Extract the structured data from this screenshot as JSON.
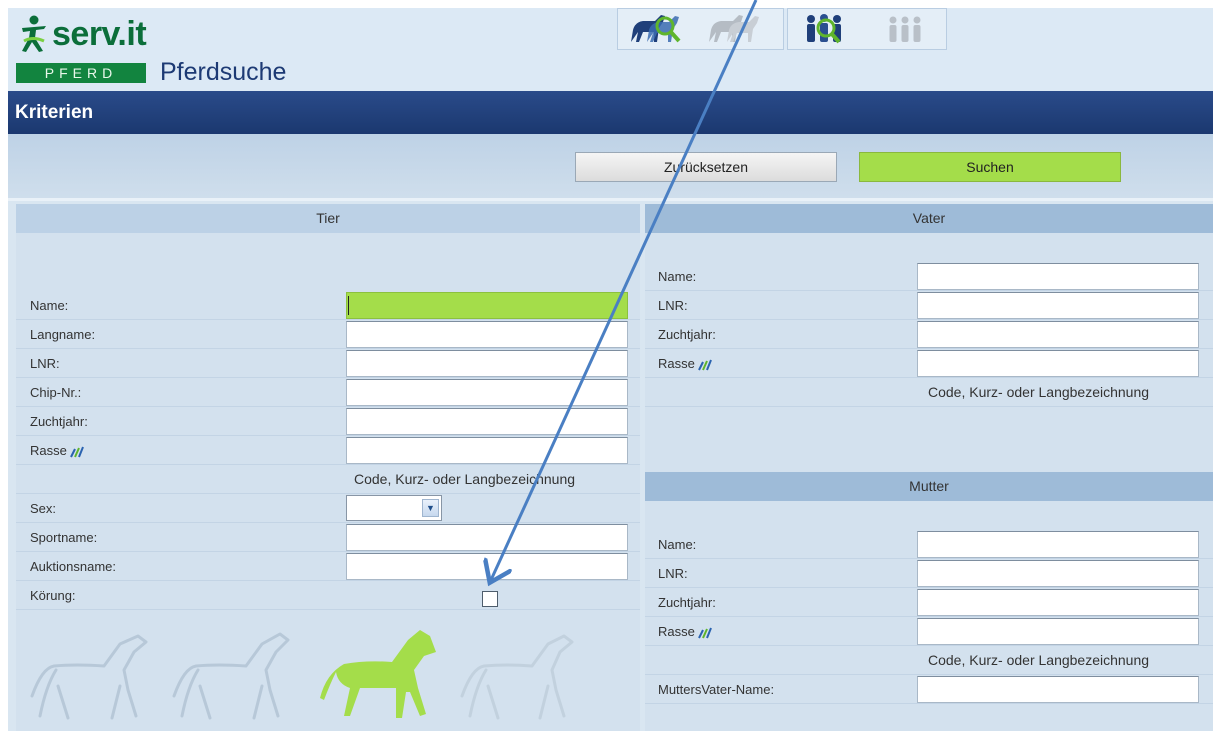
{
  "header": {
    "logo_text": "serv.it",
    "logo_sub": "PFERD",
    "title": "Pferdsuche"
  },
  "titlebar": {
    "label": "Kriterien"
  },
  "toolbar": {
    "reset_label": "Zurücksetzen",
    "search_label": "Suchen"
  },
  "tier": {
    "heading": "Tier",
    "fields": {
      "name": "Name:",
      "langname": "Langname:",
      "lnr": "LNR:",
      "chip": "Chip-Nr.:",
      "zuchtjahr": "Zuchtjahr:",
      "rasse": "Rasse",
      "sex": "Sex:",
      "sportname": "Sportname:",
      "auktionsname": "Auktionsname:",
      "koerung": "Körung:"
    },
    "hint": "Code, Kurz- oder Langbezeichnung",
    "sex_value": ""
  },
  "vater": {
    "heading": "Vater",
    "fields": {
      "name": "Name:",
      "lnr": "LNR:",
      "zuchtjahr": "Zuchtjahr:",
      "rasse": "Rasse"
    },
    "hint": "Code, Kurz- oder Langbezeichnung"
  },
  "mutter": {
    "heading": "Mutter",
    "fields": {
      "name": "Name:",
      "lnr": "LNR:",
      "zuchtjahr": "Zuchtjahr:",
      "rasse": "Rasse",
      "muttersvater": "MuttersVater-Name:"
    },
    "hint": "Code, Kurz- oder Langbezeichnung"
  },
  "colors": {
    "accent_green": "#a4dd4a",
    "title_blue": "#1b386f",
    "brand_green": "#0b6e3a"
  }
}
